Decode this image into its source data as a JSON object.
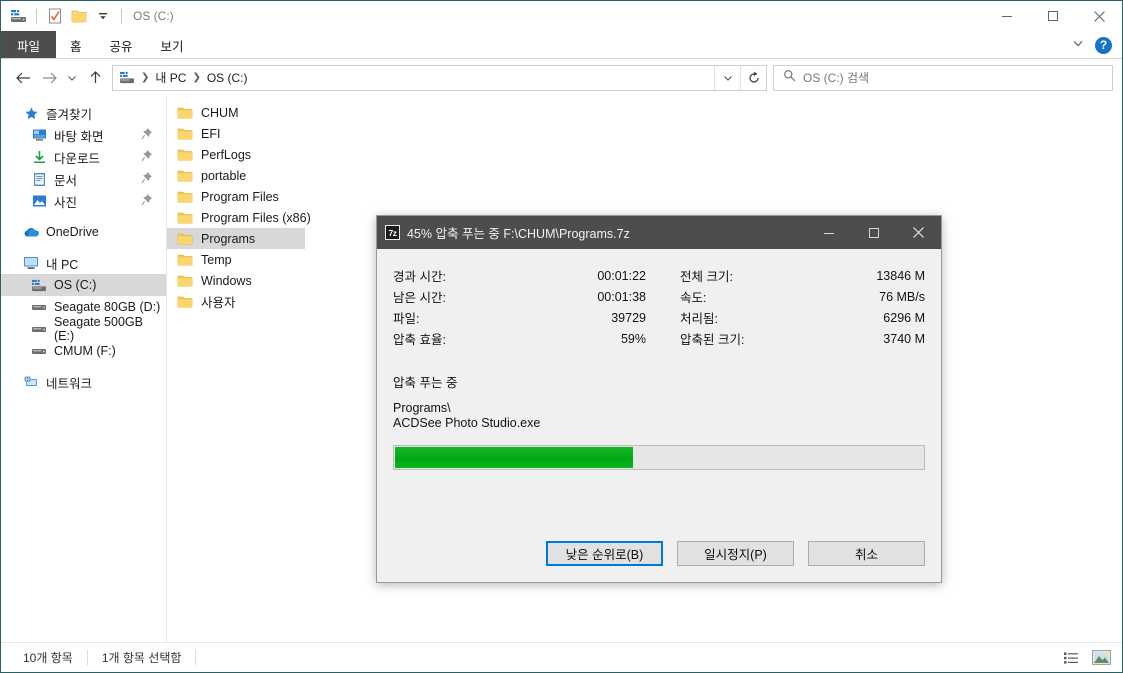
{
  "window": {
    "title": "OS (C:)",
    "quick_access": [
      {
        "name": "drive-icon",
        "label": "OS (C:)"
      },
      {
        "name": "properties-icon",
        "label": "속성"
      },
      {
        "name": "new-folder-icon",
        "label": "새 폴더"
      },
      {
        "name": "customize-dropdown-icon",
        "label": "빠른 실행 도구 모음 사용자 지정"
      }
    ],
    "controls": {
      "minimize": "─",
      "maximize": "□",
      "close": "✕"
    }
  },
  "ribbon": {
    "tabs": [
      {
        "label": "파일",
        "active": true
      },
      {
        "label": "홈",
        "active": false
      },
      {
        "label": "공유",
        "active": false
      },
      {
        "label": "보기",
        "active": false
      }
    ],
    "collapse_icon": "chevron-down-icon",
    "help_label": "?"
  },
  "addressbar": {
    "back_icon": "arrow-left-icon",
    "forward_icon": "arrow-right-icon",
    "recent_icon": "chevron-down-icon",
    "up_icon": "arrow-up-icon",
    "breadcrumbs": [
      "내 PC",
      "OS (C:)"
    ],
    "dropdown_icon": "chevron-down-icon",
    "refresh_icon": "refresh-icon"
  },
  "search": {
    "icon": "search-icon",
    "placeholder": "OS (C:) 검색",
    "value": ""
  },
  "sidebar": {
    "items": [
      {
        "label": "즐겨찾기",
        "icon": "star-icon",
        "indent": 0,
        "pinned": false,
        "selected": false
      },
      {
        "label": "바탕 화면",
        "icon": "desktop-icon",
        "indent": 1,
        "pinned": true,
        "selected": false
      },
      {
        "label": "다운로드",
        "icon": "download-icon",
        "indent": 1,
        "pinned": true,
        "selected": false
      },
      {
        "label": "문서",
        "icon": "documents-icon",
        "indent": 1,
        "pinned": true,
        "selected": false
      },
      {
        "label": "사진",
        "icon": "pictures-icon",
        "indent": 1,
        "pinned": true,
        "selected": false
      },
      {
        "label": "OneDrive",
        "icon": "onedrive-icon",
        "indent": 0,
        "pinned": false,
        "selected": false
      },
      {
        "label": "내 PC",
        "icon": "this-pc-icon",
        "indent": 0,
        "pinned": false,
        "selected": false
      },
      {
        "label": "OS (C:)",
        "icon": "drive-icon",
        "indent": 1,
        "pinned": false,
        "selected": true
      },
      {
        "label": "Seagate 80GB (D:)",
        "icon": "drive-icon",
        "indent": 1,
        "pinned": false,
        "selected": false
      },
      {
        "label": "Seagate 500GB (E:)",
        "icon": "drive-icon",
        "indent": 1,
        "pinned": false,
        "selected": false
      },
      {
        "label": "CMUM (F:)",
        "icon": "drive-icon",
        "indent": 1,
        "pinned": false,
        "selected": false
      },
      {
        "label": "네트워크",
        "icon": "network-icon",
        "indent": 0,
        "pinned": false,
        "selected": false
      }
    ]
  },
  "filelist": {
    "items": [
      {
        "name": "CHUM",
        "selected": false
      },
      {
        "name": "EFI",
        "selected": false
      },
      {
        "name": "PerfLogs",
        "selected": false
      },
      {
        "name": "portable",
        "selected": false
      },
      {
        "name": "Program Files",
        "selected": false
      },
      {
        "name": "Program Files (x86)",
        "selected": false
      },
      {
        "name": "Programs",
        "selected": true
      },
      {
        "name": "Temp",
        "selected": false
      },
      {
        "name": "Windows",
        "selected": false
      },
      {
        "name": "사용자",
        "selected": false
      }
    ]
  },
  "statusbar": {
    "item_count": "10개 항목",
    "selection": "1개 항목 선택함",
    "views": [
      {
        "name": "details-view-button",
        "active": true
      },
      {
        "name": "large-icons-view-button",
        "active": false
      }
    ]
  },
  "dialog": {
    "icon": "7z",
    "title": "45% 압축 푸는 중 F:\\CHUM\\Programs.7z",
    "percent": 45,
    "controls": {
      "minimize": "─",
      "maximize": "□",
      "close": "✕"
    },
    "stats_left": [
      {
        "label": "경과 시간:",
        "value": "00:01:22"
      },
      {
        "label": "남은 시간:",
        "value": "00:01:38"
      },
      {
        "label": "파일:",
        "value": "39729"
      },
      {
        "label": "압축 효율:",
        "value": "59%"
      }
    ],
    "stats_right": [
      {
        "label": "전체 크기:",
        "value": "13846 M"
      },
      {
        "label": "속도:",
        "value": "76 MB/s"
      },
      {
        "label": "처리됨:",
        "value": "6296 M"
      },
      {
        "label": "압축된 크기:",
        "value": "3740 M"
      }
    ],
    "operation": "압축 푸는 중",
    "path_line1": "Programs\\",
    "path_line2": "ACDSee Photo Studio.exe",
    "buttons": [
      {
        "label": "낮은 순위로(B)",
        "focused": true
      },
      {
        "label": "일시정지(P)",
        "focused": false
      },
      {
        "label": "취소",
        "focused": false
      }
    ],
    "progress_color": "#06ae18"
  }
}
